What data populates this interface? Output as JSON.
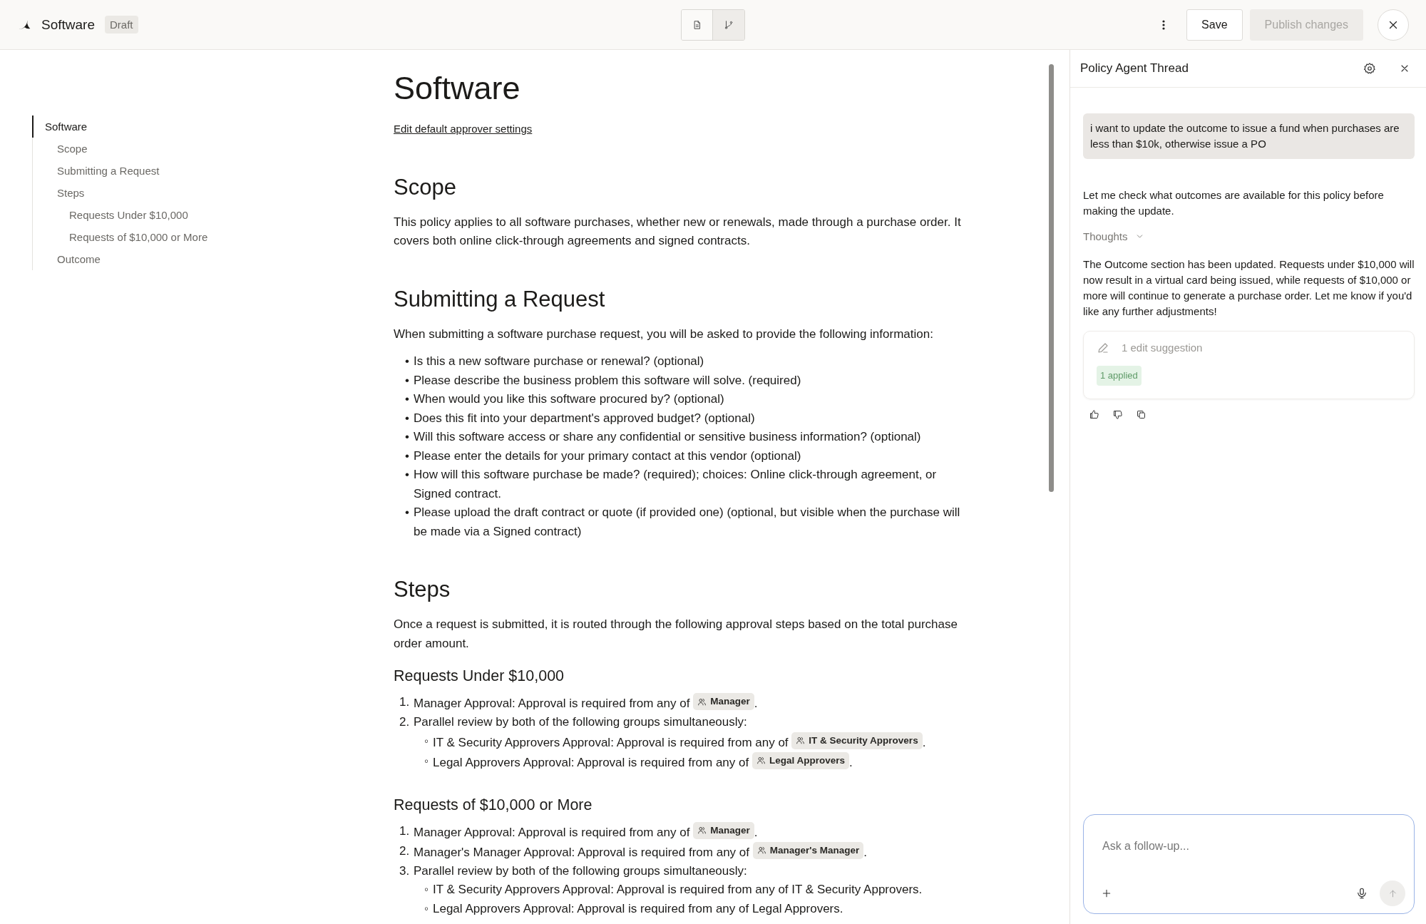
{
  "header": {
    "title": "Software",
    "badge": "Draft",
    "view_toggle": [
      {
        "kind": "document",
        "selected": true
      },
      {
        "kind": "branch",
        "selected": false
      }
    ],
    "buttons": [
      {
        "label": "Save",
        "disabled": false
      },
      {
        "label": "Publish changes",
        "disabled": true
      }
    ]
  },
  "outline": [
    {
      "label": "Software",
      "selected": true,
      "children": [
        {
          "label": "Scope",
          "selected": false
        },
        {
          "label": "Submitting a Request",
          "selected": false
        },
        {
          "label": "Steps",
          "selected": false,
          "children": [
            {
              "label": "Requests Under $10,000",
              "selected": false
            },
            {
              "label": "Requests of $10,000 or More",
              "selected": false
            }
          ]
        },
        {
          "label": "Outcome",
          "selected": false
        }
      ]
    }
  ],
  "document": {
    "title": "Software",
    "link": "Edit default approver settings",
    "sections": [
      {
        "kind": "section",
        "heading": "Scope",
        "blocks": [
          {
            "kind": "paragraph",
            "text": "This policy applies to all software purchases, whether new or renewals, made through a purchase order. It covers both online click-through agreements and signed contracts."
          }
        ]
      },
      {
        "kind": "section",
        "heading": "Submitting a Request",
        "blocks": [
          {
            "kind": "paragraph",
            "text": "When submitting a software purchase request, you will be asked to provide the following information:"
          },
          {
            "kind": "list",
            "items": [
              {
                "marker": "•",
                "text": "Is this a new software purchase or renewal? (optional)"
              },
              {
                "marker": "•",
                "text": "Please describe the business problem this software will solve. (required)"
              },
              {
                "marker": "•",
                "text": "When would you like this software procured by? (optional)"
              },
              {
                "marker": "•",
                "text": "Does this fit into your department's approved budget? (optional)"
              },
              {
                "marker": "•",
                "text": "Will this software access or share any confidential or sensitive business information? (optional)"
              },
              {
                "marker": "•",
                "text": "Please enter the details for your primary contact at this vendor (optional)"
              },
              {
                "marker": "•",
                "text": "How will this software purchase be made? (required); choices: Online click-through agreement, or Signed contract."
              },
              {
                "marker": "•",
                "text": "Please upload the draft contract or quote (if provided one) (optional, but visible when the purchase will be made via a Signed contract)"
              }
            ]
          }
        ]
      },
      {
        "kind": "section",
        "heading": "Steps",
        "blocks": [
          {
            "kind": "paragraph",
            "text": "Once a request is submitted, it is routed through the following approval steps based on the total purchase order amount."
          }
        ]
      },
      {
        "kind": "subsection",
        "heading": "Requests Under $10,000",
        "blocks": [
          {
            "kind": "list",
            "items": [
              {
                "marker": "1.",
                "text": "Manager Approval: Approval is required from any of",
                "chip": "Manager",
                "end": "."
              },
              {
                "marker": "2.",
                "text": "Parallel review by both of the following groups simultaneously:",
                "children": [
                  {
                    "marker": "◦",
                    "text": "IT & Security Approvers Approval: Approval is required from any of",
                    "chip": "IT & Security Approvers",
                    "end": "."
                  },
                  {
                    "marker": "◦",
                    "text": "Legal Approvers Approval: Approval is required from any of",
                    "chip": "Legal Approvers",
                    "end": "."
                  }
                ]
              }
            ]
          }
        ]
      },
      {
        "kind": "subsection",
        "heading": "Requests of $10,000 or More",
        "blocks": [
          {
            "kind": "list",
            "items": [
              {
                "marker": "1.",
                "text": "Manager Approval: Approval is required from any of",
                "chip": "Manager",
                "end": "."
              },
              {
                "marker": "2.",
                "text": "Manager's Manager Approval: Approval is required from any of",
                "chip": "Manager's Manager",
                "end": "."
              },
              {
                "marker": "3.",
                "text": "Parallel review by both of the following groups simultaneously:",
                "children": [
                  {
                    "marker": "◦",
                    "text": "IT & Security Approvers Approval: Approval is required from any of IT & Security Approvers."
                  },
                  {
                    "marker": "◦",
                    "text": "Legal Approvers Approval: Approval is required from any of Legal Approvers."
                  }
                ]
              }
            ]
          }
        ]
      }
    ]
  },
  "thread": {
    "title": "Policy Agent Thread",
    "messages": [
      {
        "kind": "user",
        "text": "i want to update the outcome to issue a fund when purchases are less than $10k, otherwise issue a PO"
      },
      {
        "kind": "assistant",
        "text": "Let me check what outcomes are available for this policy before making the update."
      },
      {
        "kind": "thoughts",
        "label": "Thoughts",
        "expanded": false
      },
      {
        "kind": "assistant",
        "text": "The Outcome section has been updated. Requests under $10,000 will now result in a virtual card being issued, while requests of $10,000 or more will continue to generate a purchase order. Let me know if you'd like any further adjustments!"
      },
      {
        "kind": "suggestion",
        "label": "1 edit suggestion",
        "status": "1 applied"
      },
      {
        "kind": "feedback"
      }
    ],
    "input": {
      "placeholder": "Ask a follow-up...",
      "send_disabled": true
    }
  }
}
